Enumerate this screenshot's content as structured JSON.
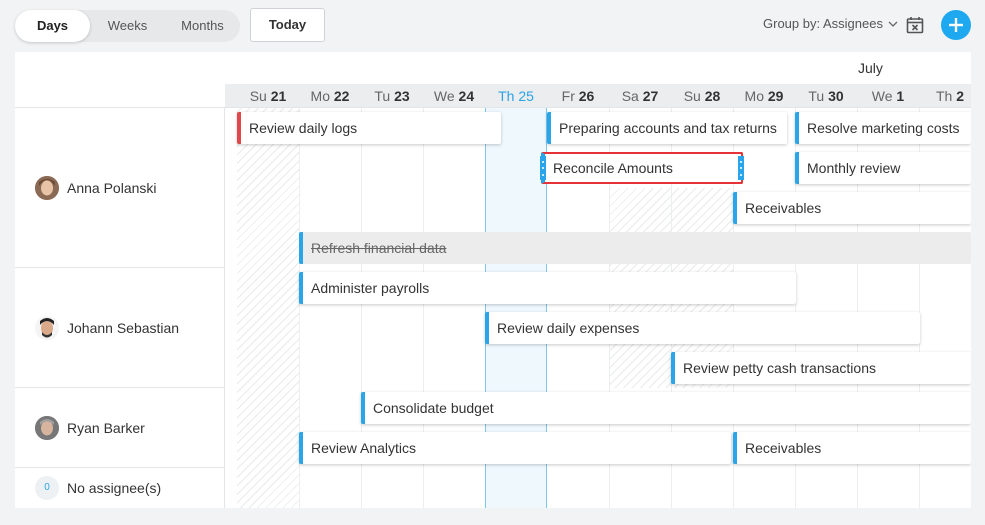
{
  "toolbar": {
    "views": [
      "Days",
      "Weeks",
      "Months"
    ],
    "active_view": "Days",
    "today_label": "Today",
    "group_by_label": "Group by: Assignees"
  },
  "calendar": {
    "month_label": "July",
    "days": [
      {
        "dow": "Su",
        "num": "21"
      },
      {
        "dow": "Mo",
        "num": "22"
      },
      {
        "dow": "Tu",
        "num": "23"
      },
      {
        "dow": "We",
        "num": "24"
      },
      {
        "dow": "Th",
        "num": "25",
        "today": true
      },
      {
        "dow": "Fr",
        "num": "26"
      },
      {
        "dow": "Sa",
        "num": "27"
      },
      {
        "dow": "Su",
        "num": "28"
      },
      {
        "dow": "Mo",
        "num": "29"
      },
      {
        "dow": "Tu",
        "num": "30"
      },
      {
        "dow": "We",
        "num": "1"
      },
      {
        "dow": "Th",
        "num": "2"
      }
    ]
  },
  "assignees": [
    {
      "name": "Anna Polanski"
    },
    {
      "name": "Johann Sebastian"
    },
    {
      "name": "Ryan Barker"
    },
    {
      "name": "No assignee(s)",
      "count": "0"
    }
  ],
  "tasks": [
    {
      "title": "Review daily logs",
      "assignee": "Anna Polanski"
    },
    {
      "title": "Preparing accounts and tax returns",
      "assignee": "Anna Polanski"
    },
    {
      "title": "Resolve marketing costs",
      "assignee": "Anna Polanski"
    },
    {
      "title": "Reconcile Amounts",
      "assignee": "Anna Polanski",
      "selected": true
    },
    {
      "title": "Monthly review",
      "assignee": "Anna Polanski"
    },
    {
      "title": "Receivables",
      "assignee": "Anna Polanski"
    },
    {
      "title": "Refresh financial data",
      "assignee": "Anna Polanski",
      "completed": true
    },
    {
      "title": "Administer payrolls",
      "assignee": "Johann Sebastian"
    },
    {
      "title": "Review daily expenses",
      "assignee": "Johann Sebastian"
    },
    {
      "title": "Review petty cash transactions",
      "assignee": "Johann Sebastian"
    },
    {
      "title": "Consolidate budget",
      "assignee": "Ryan Barker"
    },
    {
      "title": "Review Analytics",
      "assignee": "Ryan Barker"
    },
    {
      "title": "Receivables",
      "assignee": "Ryan Barker"
    }
  ],
  "colors": {
    "accent": "#2ba5ea",
    "today": "#2aa4e6",
    "danger": "#e0474c",
    "add_button": "#1da8f0"
  }
}
